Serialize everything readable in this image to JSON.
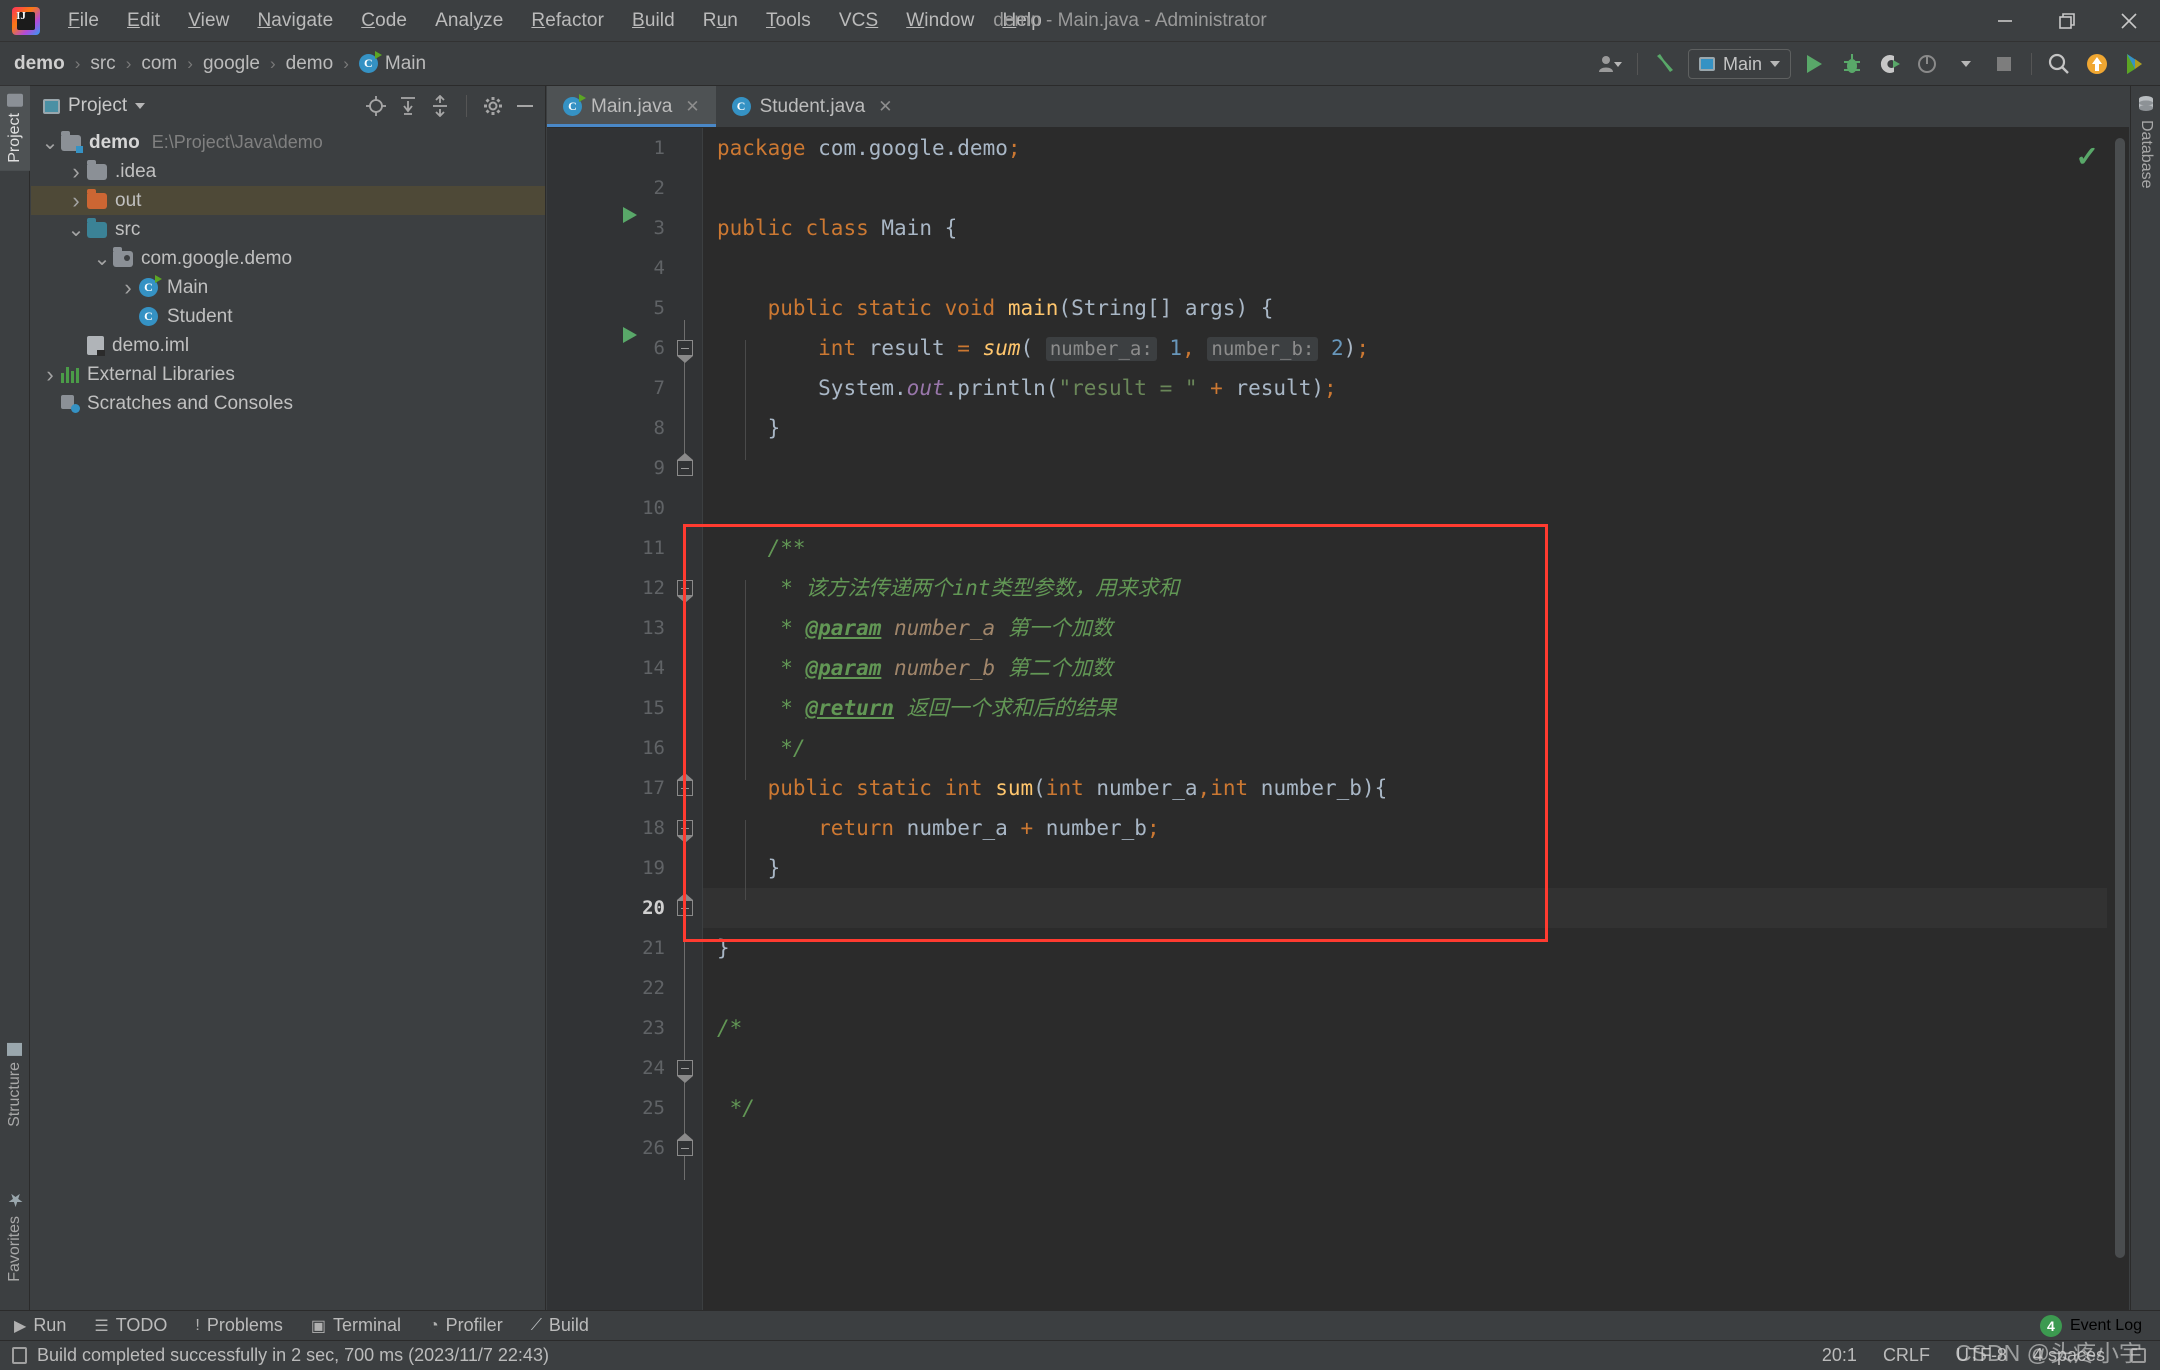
{
  "window": {
    "title": "demo - Main.java - Administrator",
    "minimize": "–",
    "maximize": "❐",
    "close": "✕"
  },
  "menubar": {
    "items": [
      {
        "label": "File",
        "mnemonic": "F"
      },
      {
        "label": "Edit",
        "mnemonic": "E"
      },
      {
        "label": "View",
        "mnemonic": "V"
      },
      {
        "label": "Navigate",
        "mnemonic": "N"
      },
      {
        "label": "Code",
        "mnemonic": "C"
      },
      {
        "label": "Analyze",
        "mnemonic": "y"
      },
      {
        "label": "Refactor",
        "mnemonic": "R"
      },
      {
        "label": "Build",
        "mnemonic": "B"
      },
      {
        "label": "Run",
        "mnemonic": "u"
      },
      {
        "label": "Tools",
        "mnemonic": "T"
      },
      {
        "label": "VCS",
        "mnemonic": "S"
      },
      {
        "label": "Window",
        "mnemonic": "W"
      },
      {
        "label": "Help",
        "mnemonic": "H"
      }
    ]
  },
  "navbar": {
    "crumbs": [
      "demo",
      "src",
      "com",
      "google",
      "demo",
      "Main"
    ],
    "separator": "›",
    "run_config": "Main",
    "icons": {
      "profile": "user-icon",
      "build": "build-hammer-icon",
      "run": "run-icon",
      "debug": "debug-icon",
      "run_coverage": "run-with-coverage-icon",
      "profiler": "profiler-icon",
      "stop": "stop-icon",
      "search": "search-everywhere-icon",
      "update": "update-project-icon",
      "ide_extra": "ide-extra-icon"
    }
  },
  "left_stripe": {
    "tabs": [
      "Project",
      "Structure",
      "Favorites"
    ]
  },
  "right_stripe": {
    "tabs": [
      "Database"
    ]
  },
  "project_panel": {
    "title": "Project",
    "tools": [
      "locate-icon",
      "expand-all-icon",
      "collapse-all-icon",
      "settings-gear-icon",
      "hide-icon"
    ],
    "tree": [
      {
        "label": "demo",
        "path": "E:\\Project\\Java\\demo",
        "indent": 0,
        "arrow": "expanded",
        "icon": "project-folder",
        "bold": true,
        "selected": false
      },
      {
        "label": ".idea",
        "path": "",
        "indent": 1,
        "arrow": "collapsed",
        "icon": "folder-grey",
        "bold": false,
        "selected": false
      },
      {
        "label": "out",
        "path": "",
        "indent": 1,
        "arrow": "collapsed",
        "icon": "folder-orange",
        "bold": false,
        "selected": true
      },
      {
        "label": "src",
        "path": "",
        "indent": 1,
        "arrow": "expanded",
        "icon": "folder-blue",
        "bold": false,
        "selected": false
      },
      {
        "label": "com.google.demo",
        "path": "",
        "indent": 2,
        "arrow": "expanded",
        "icon": "package",
        "bold": false,
        "selected": false
      },
      {
        "label": "Main",
        "path": "",
        "indent": 3,
        "arrow": "collapsed",
        "icon": "class-runnable",
        "bold": false,
        "selected": false
      },
      {
        "label": "Student",
        "path": "",
        "indent": 3,
        "arrow": "none",
        "icon": "class",
        "bold": false,
        "selected": false
      },
      {
        "label": "demo.iml",
        "path": "",
        "indent": 1,
        "arrow": "none",
        "icon": "iml",
        "bold": false,
        "selected": false
      },
      {
        "label": "External Libraries",
        "path": "",
        "indent": 0,
        "arrow": "collapsed",
        "icon": "libraries",
        "bold": false,
        "selected": false
      },
      {
        "label": "Scratches and Consoles",
        "path": "",
        "indent": 0,
        "arrow": "none",
        "icon": "scratches",
        "bold": false,
        "selected": false
      }
    ]
  },
  "editor": {
    "tabs": [
      {
        "label": "Main.java",
        "icon": "class-runnable",
        "active": true,
        "close": "✕"
      },
      {
        "label": "Student.java",
        "icon": "class",
        "active": false,
        "close": "✕"
      }
    ],
    "inspection_status": "✓",
    "current_line": 20,
    "lines": [
      {
        "n": 1,
        "text": "package com.google.demo;"
      },
      {
        "n": 2,
        "text": ""
      },
      {
        "n": 3,
        "text": "public class Main {"
      },
      {
        "n": 4,
        "text": ""
      },
      {
        "n": 5,
        "text": "    public static void main(String[] args) {"
      },
      {
        "n": 6,
        "text": "        int result = sum( number_a: 1, number_b: 2);"
      },
      {
        "n": 7,
        "text": "        System.out.println(\"result = \" + result);"
      },
      {
        "n": 8,
        "text": "    }"
      },
      {
        "n": 9,
        "text": ""
      },
      {
        "n": 10,
        "text": ""
      },
      {
        "n": 11,
        "text": "    /**"
      },
      {
        "n": 12,
        "text": "     * 该方法传递两个int类型参数，用来求和"
      },
      {
        "n": 13,
        "text": "     * @param number_a 第一个加数"
      },
      {
        "n": 14,
        "text": "     * @param number_b 第二个加数"
      },
      {
        "n": 15,
        "text": "     * @return 返回一个求和后的结果"
      },
      {
        "n": 16,
        "text": "     */"
      },
      {
        "n": 17,
        "text": "    public static int sum(int number_a,int number_b){"
      },
      {
        "n": 18,
        "text": "        return number_a + number_b;"
      },
      {
        "n": 19,
        "text": "    }"
      },
      {
        "n": 20,
        "text": ""
      },
      {
        "n": 21,
        "text": "}"
      },
      {
        "n": 22,
        "text": ""
      },
      {
        "n": 23,
        "text": "/*"
      },
      {
        "n": 24,
        "text": ""
      },
      {
        "n": 25,
        "text": " */"
      },
      {
        "n": 26,
        "text": ""
      }
    ],
    "inlay_hints": [
      "number_a:",
      "number_b:"
    ],
    "annotation": {
      "type": "red-rectangle",
      "covers_lines": "11-20",
      "color": "#ff3b30"
    }
  },
  "bottom_bar": {
    "items": [
      {
        "label": "Run",
        "icon": "run-icon"
      },
      {
        "label": "TODO",
        "icon": "todo-icon"
      },
      {
        "label": "Problems",
        "icon": "problems-icon"
      },
      {
        "label": "Terminal",
        "icon": "terminal-icon"
      },
      {
        "label": "Profiler",
        "icon": "profiler-icon"
      },
      {
        "label": "Build",
        "icon": "build-hammer-icon"
      }
    ],
    "event_log": {
      "label": "Event Log",
      "count": "4"
    }
  },
  "status_bar": {
    "message": "Build completed successfully in 2 sec, 700 ms (2023/11/7 22:43)",
    "caret": "20:1",
    "line_separator": "CRLF",
    "encoding": "UTF-8",
    "indent": "4 spaces",
    "lock": "lock-icon",
    "watermark": "CSDN @头疼小宇"
  },
  "colors": {
    "bg_panel": "#3c3f41",
    "bg_editor": "#2b2b2b",
    "accent_blue": "#4a88c7",
    "keyword_orange": "#cc7832",
    "string_green": "#6a8759",
    "comment_green": "#629755",
    "number_blue": "#6897bb",
    "method_yellow": "#ffc66d",
    "annotation_red": "#ff3b30",
    "selection_gold": "#4e4937"
  }
}
